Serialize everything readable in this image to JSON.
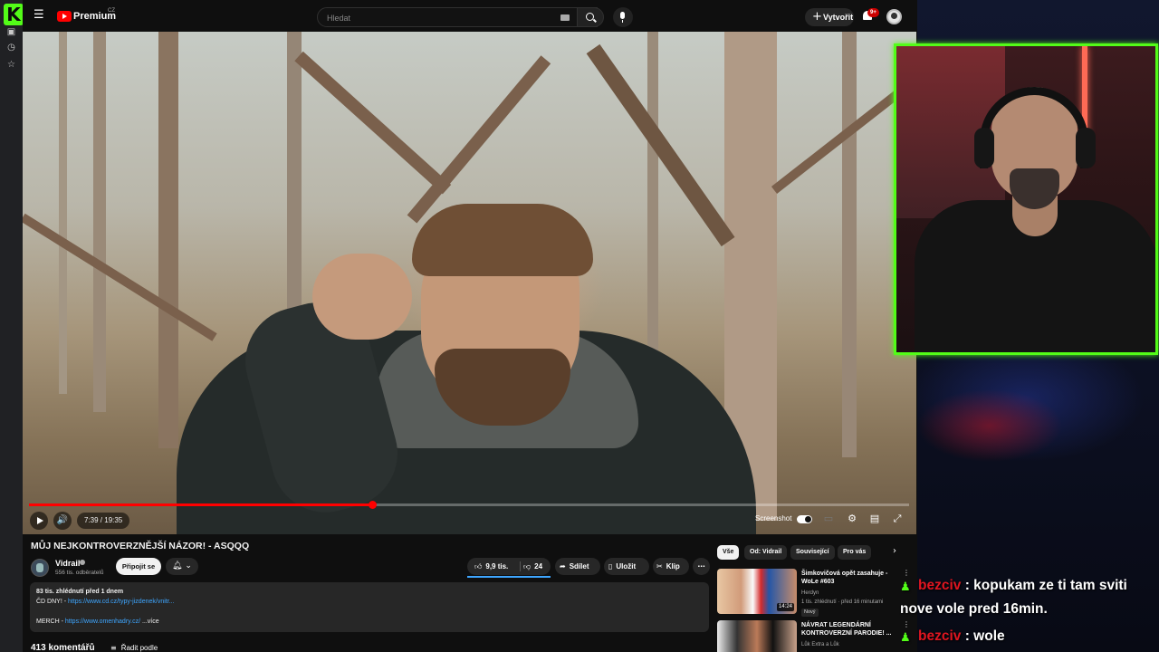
{
  "youtube": {
    "brand": "Premium",
    "country": "CZ",
    "search_placeholder": "Hledat",
    "create_label": "Vytvořit",
    "notification_count": "9+"
  },
  "player": {
    "time": "7:39 / 19:35",
    "progress_fraction": 0.39,
    "screenshot_label": "Screenshot"
  },
  "video": {
    "title": "MŮJ NEJKONTROVERZNĚJŠÍ NÁZOR! - ASQQQ",
    "channel": "Vidrail",
    "subscribers": "556 tis. odběratelů",
    "join_label": "Připojit se",
    "likes": "9,9 tis.",
    "dislikes": "24",
    "share_label": "Sdílet",
    "save_label": "Uložit",
    "clip_label": "Klip",
    "more_label": "⋯"
  },
  "description": {
    "stats": "83 tis. zhlédnutí  před 1 dnem",
    "line2_prefix": "ČD DNY! - ",
    "line2_link": "https://www.cd.cz/typy-jizdenek/vnitr...",
    "line3_prefix": "MERCH - ",
    "line3_link": "https://www.omenhadry.cz/",
    "line3_more": "  ...více"
  },
  "comments": {
    "count": "413 komentářů",
    "sort_label": "Řadit podle"
  },
  "chips": [
    "Vše",
    "Od: Vidrail",
    "Související",
    "Pro vás"
  ],
  "recommendations": [
    {
      "title": "Šimkovičová opět zasahuje - WoLe #603",
      "channel": "Herdyn",
      "meta": "1 tis. zhlédnutí · před 16 minutami",
      "duration": "14:24",
      "badge": "Nový"
    },
    {
      "title": "NÁVRAT LEGENDÁRNÍ KONTROVERZNÍ PARODIE! ...",
      "channel": "Lůk Extra a Lůk"
    }
  ],
  "chat": [
    {
      "user": "bezciv",
      "text": " : kopukam ze ti tam sviti"
    },
    {
      "user": "",
      "text": "nove vole pred 16min."
    },
    {
      "user": "bezciv",
      "text": " : wole"
    }
  ],
  "icons": {
    "kick_logo": "K",
    "hamburger": "☰",
    "plus": "+",
    "volume": "🔊"
  },
  "colors": {
    "kick_green": "#53fc18",
    "youtube_red": "#ff0000",
    "chat_user": "#e01520",
    "link_blue": "#3ea6ff"
  }
}
